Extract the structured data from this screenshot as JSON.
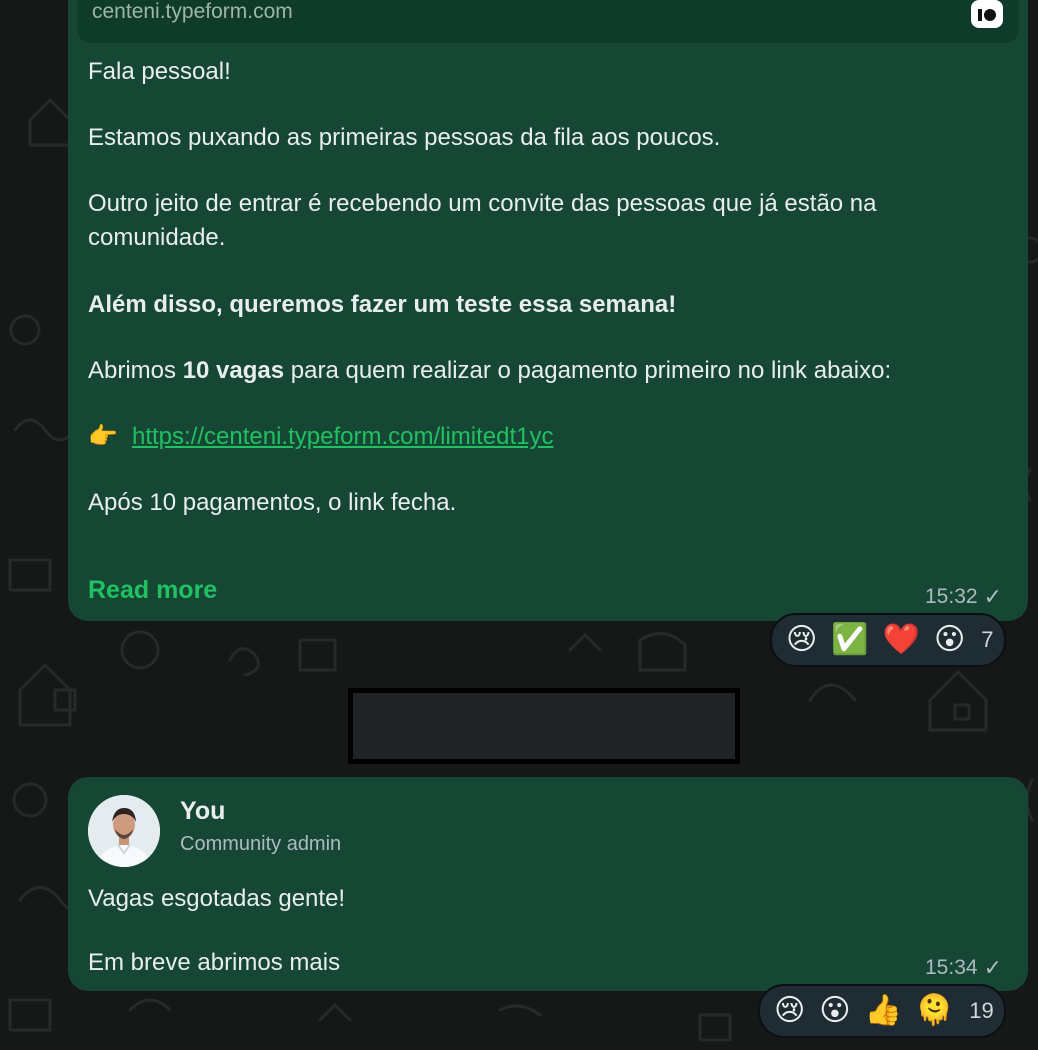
{
  "chat": {
    "message1": {
      "preview_domain": "centeni.typeform.com",
      "preview_icon": "typeform-icon",
      "lines": {
        "greeting": "Fala pessoal!",
        "queue": "Estamos puxando as primeiras pessoas da fila aos poucos.",
        "invite_line1": "Outro jeito de entrar é recebendo um convite das pessoas que já estão na",
        "invite_line2": "comunidade.",
        "test_week": "Além disso, queremos fazer um teste essa semana!",
        "open_prefix": "Abrimos ",
        "open_bold": "10 vagas",
        "open_suffix": " para quem realizar o pagamento primeiro no link abaixo:",
        "pointer_emoji": "👉",
        "link": "https://centeni.typeform.com/limitedt1yc",
        "closing": "Após 10 pagamentos, o link fecha."
      },
      "read_more": "Read more",
      "time": "15:32",
      "status_icon": "✓",
      "reactions": {
        "emojis": [
          "😢",
          "✅",
          "❤️",
          "😮"
        ],
        "count": "7"
      }
    },
    "message2": {
      "sender_name": "You",
      "sender_role": "Community admin",
      "line1": "Vagas esgotadas gente!",
      "line2": "Em breve abrimos mais",
      "time": "15:34",
      "status_icon": "✓",
      "reactions": {
        "emojis": [
          "😢",
          "😮",
          "👍",
          "🫠"
        ],
        "count": "19"
      }
    }
  },
  "colors": {
    "background": "#161717",
    "bubble": "#154734",
    "link": "#21c063",
    "meta": "#aebac1"
  }
}
